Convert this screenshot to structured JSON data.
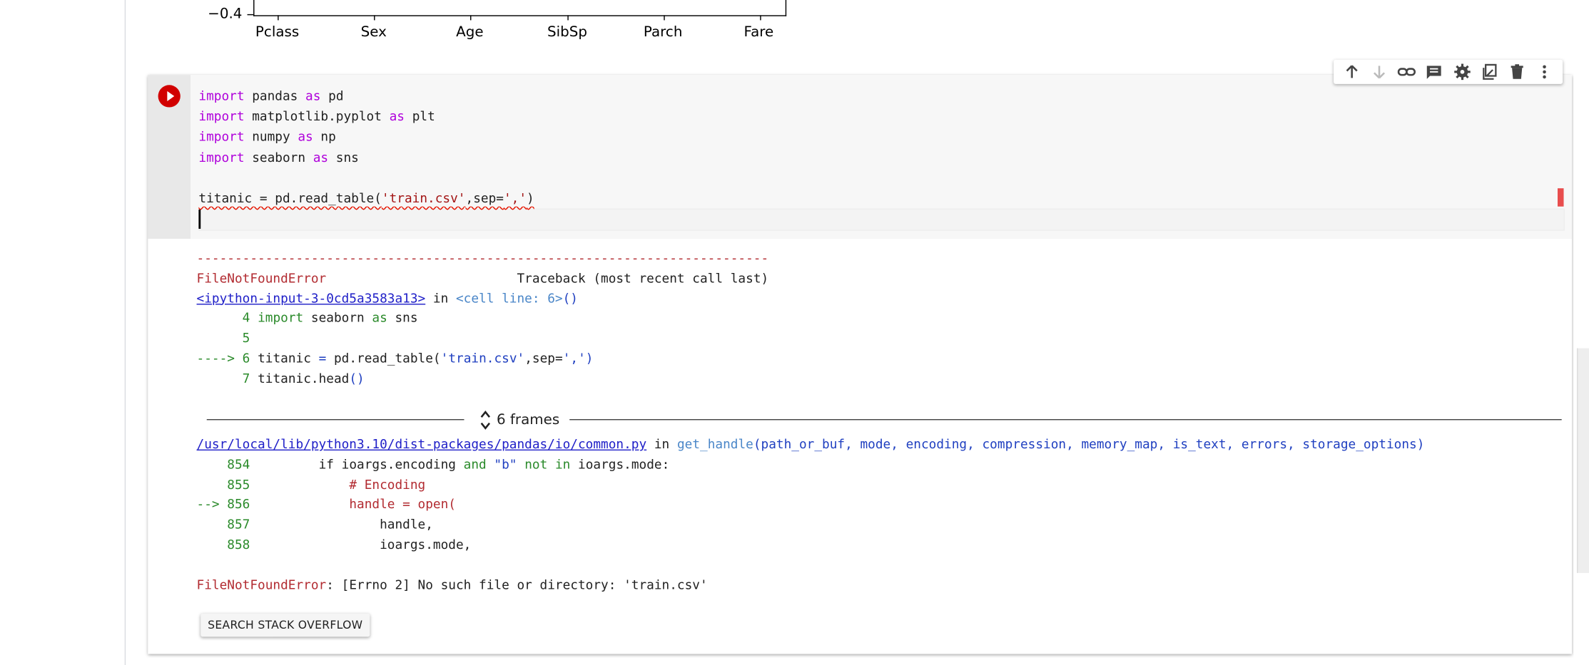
{
  "plot": {
    "ytick": "−0.4",
    "xticks": [
      "Pclass",
      "Sex",
      "Age",
      "SibSp",
      "Parch",
      "Fare"
    ]
  },
  "toolbar": {
    "move_up": "move-up",
    "move_down": "move-down",
    "link": "link",
    "comment": "comment",
    "settings": "settings",
    "mirror": "mirror-cell",
    "delete": "delete",
    "more": "more"
  },
  "code": {
    "lines": [
      {
        "kw1": "import",
        "rest1": " pandas ",
        "kw2": "as",
        "rest2": " pd"
      },
      {
        "kw1": "import",
        "rest1": " matplotlib.pyplot ",
        "kw2": "as",
        "rest2": " plt"
      },
      {
        "kw1": "import",
        "rest1": " numpy ",
        "kw2": "as",
        "rest2": " np"
      },
      {
        "kw1": "import",
        "rest1": " seaborn ",
        "kw2": "as",
        "rest2": " sns"
      }
    ],
    "line6_pre": "titanic = pd.read_table(",
    "line6_str1": "'train.csv'",
    "line6_mid": ",sep=",
    "line6_str2": "','",
    "line6_post": ")"
  },
  "traceback": {
    "dashes": "---------------------------------------------------------------------------",
    "error_name": "FileNotFoundError",
    "header_right": "                         Traceback (most recent call last)",
    "input_link": "<ipython-input-3-0cd5a3583a13>",
    "in_text": " in ",
    "cell_line": "<cell line: 6>",
    "cell_paren": "()",
    "l4_num": "      4 ",
    "l4_kw": "import",
    "l4_mid": " seaborn ",
    "l4_kw2": "as",
    "l4_end": " sns",
    "l5_num": "      5 ",
    "l6_arrow": "----> 6 ",
    "l6_code_a": "titanic ",
    "l6_eq": "=",
    "l6_code_b": " pd.read_table(",
    "l6_str1": "'train.csv'",
    "l6_mid": ",sep=",
    "l6_str2": "','",
    "l6_end": ")",
    "l7_num": "      7 ",
    "l7_code": "titanic.head",
    "l7_paren": "()",
    "frames_label": "6 frames",
    "file_link": "/usr/local/lib/python3.10/dist-packages/pandas/io/common.py",
    "in2": " in ",
    "func": "get_handle",
    "args": "(path_or_buf, mode, encoding, compression, memory_map, is_text, errors, storage_options)",
    "f854_num": "    854 ",
    "f854_code_a": "        if ioargs.encoding ",
    "f854_and": "and",
    "f854_str": " \"b\" ",
    "f854_not": "not in",
    "f854_end": " ioargs.mode:",
    "f855_num": "    855 ",
    "f855_code": "            # Encoding",
    "f856_arrow": "--> 856 ",
    "f856_code": "            handle = open(",
    "f857_num": "    857 ",
    "f857_code": "                handle,",
    "f858_num": "    858 ",
    "f858_code": "                ioargs.mode,",
    "final_err": "FileNotFoundError",
    "final_msg": ": [Errno 2] No such file or directory: 'train.csv'"
  },
  "so_button": "SEARCH STACK OVERFLOW"
}
